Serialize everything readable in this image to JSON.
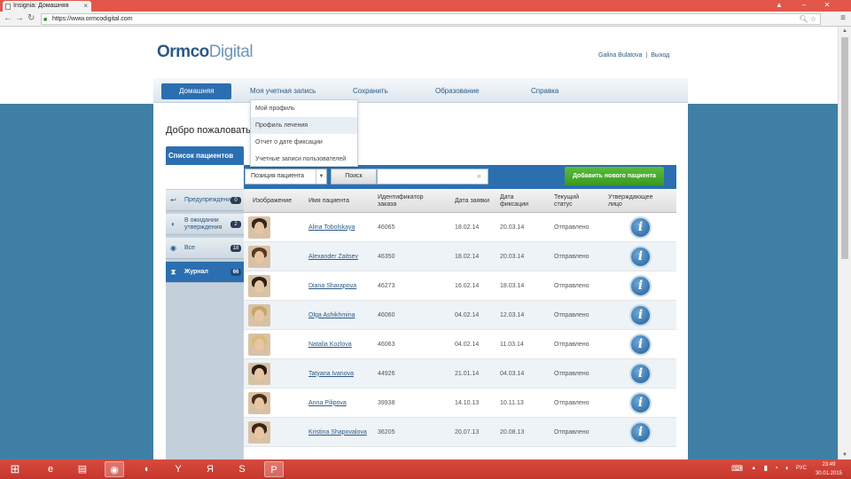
{
  "browser": {
    "tab_title": "Insignia: Домашняя",
    "url": "https://www.ormcodigital.com",
    "close_tab": "×"
  },
  "site": {
    "logo_bold": "Ormco",
    "logo_light": "Digital",
    "user_name": "Galina Bulatova",
    "separator": "|",
    "logout": "Выход"
  },
  "nav": {
    "items": [
      "Домашняя",
      "Моя учетная запись",
      "Сохранить",
      "Образование",
      "Справка"
    ]
  },
  "welcome": "Добро пожаловать",
  "dropdown": {
    "items": [
      "Мой профиль",
      "Профиль лечения",
      "Отчет о дате фиксации",
      "Учетные записи пользователей"
    ]
  },
  "panel": {
    "tab_label": "Список пациентов",
    "filter_value": "Позиция пациента",
    "search_button": "Поиск",
    "add_button": "Добавить нового пациента"
  },
  "sidebar": {
    "items": [
      {
        "label": "Предупреждения",
        "count": "0",
        "icon": "warning-icon"
      },
      {
        "label": "В ожидании утверждения",
        "count": "2",
        "icon": "hourglass-icon"
      },
      {
        "label": "Все",
        "count": "18",
        "icon": "eye-icon"
      },
      {
        "label": "Журнал",
        "count": "66",
        "icon": "journal-icon"
      }
    ]
  },
  "table": {
    "headers": [
      "Изображение",
      "Имя пациента",
      "Идентификатор заказа",
      "Дата заявки",
      "Дата фиксации",
      "Текущий статус",
      "Утверждающее лицо"
    ],
    "rows": [
      {
        "name": "Alina Tobolskaya",
        "id": "46065",
        "date_req": "18.02.14",
        "date_fix": "20.03.14",
        "status": "Отправлено"
      },
      {
        "name": "Alexander Zaitsev",
        "id": "46350",
        "date_req": "18.02.14",
        "date_fix": "20.03.14",
        "status": "Отправлено"
      },
      {
        "name": "Diana Sharapova",
        "id": "46273",
        "date_req": "16.02.14",
        "date_fix": "18.03.14",
        "status": "Отправлено"
      },
      {
        "name": "Olga Ashikhmina",
        "id": "46060",
        "date_req": "04.02.14",
        "date_fix": "12.03.14",
        "status": "Отправлено"
      },
      {
        "name": "Natalia Kozlova",
        "id": "46063",
        "date_req": "04.02.14",
        "date_fix": "11.03.14",
        "status": "Отправлено"
      },
      {
        "name": "Tatyana Ivanova",
        "id": "44926",
        "date_req": "21.01.14",
        "date_fix": "04.03.14",
        "status": "Отправлено"
      },
      {
        "name": "Anna Pilipova",
        "id": "39938",
        "date_req": "14.10.13",
        "date_fix": "10.11.13",
        "status": "Отправлено"
      },
      {
        "name": "Kristina Shapovalova",
        "id": "36205",
        "date_req": "20.07.13",
        "date_fix": "20.08.13",
        "status": "Отправлено"
      }
    ]
  },
  "clock": {
    "time": "23:49",
    "date": "30.01.2015",
    "lang": "РУС"
  },
  "colors": {
    "brand_blue": "#2c6fb0",
    "add_green": "#4aab2e",
    "taskbar_red": "#d64a3e"
  }
}
